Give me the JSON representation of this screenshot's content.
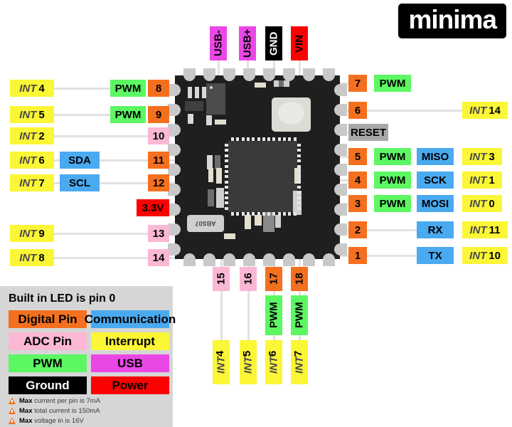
{
  "logo": {
    "text": "minima"
  },
  "legend": {
    "title": "Built in LED is pin 0",
    "items": [
      {
        "label": "Digital Pin",
        "color": "#f4701f",
        "text_color": "#000000"
      },
      {
        "label": "Communication",
        "color": "#4aaaf0",
        "text_color": "#000000"
      },
      {
        "label": "ADC Pin",
        "color": "#fbb8d4",
        "text_color": "#000000"
      },
      {
        "label": "Interrupt",
        "color": "#fbf636",
        "text_color": "#000000"
      },
      {
        "label": "PWM",
        "color": "#5cf763",
        "text_color": "#000000"
      },
      {
        "label": "USB",
        "color": "#ea47e6",
        "text_color": "#000000"
      },
      {
        "label": "Ground",
        "color": "#000000",
        "text_color": "#ffffff"
      },
      {
        "label": "Power",
        "color": "#fb0101",
        "text_color": "#000000"
      }
    ],
    "warnings": [
      {
        "bold": "Max",
        "rest": " current per pin is 7mA"
      },
      {
        "bold": "Max",
        "rest": " total current is 150mA"
      },
      {
        "bold": "Max",
        "rest": " voltage in is 16V"
      }
    ]
  },
  "top_pins": [
    {
      "label": "USB-",
      "type": "usb"
    },
    {
      "label": "USB+",
      "type": "usb"
    },
    {
      "label": "GND",
      "type": "ground"
    },
    {
      "label": "VIN",
      "type": "power"
    }
  ],
  "bottom_pins": [
    {
      "pin": "15",
      "pin_type": "adc",
      "pwm": "",
      "int_tag": "INT",
      "int_num": "4"
    },
    {
      "pin": "16",
      "pin_type": "adc",
      "pwm": "",
      "int_tag": "INT",
      "int_num": "5"
    },
    {
      "pin": "17",
      "pin_type": "digital",
      "pwm": "PWM",
      "int_tag": "INT",
      "int_num": "6"
    },
    {
      "pin": "18",
      "pin_type": "digital",
      "pwm": "PWM",
      "int_tag": "INT",
      "int_num": "7"
    }
  ],
  "left_pins": [
    {
      "int_tag": "INT",
      "int_num": "4",
      "comm": "",
      "extra": "PWM",
      "extra_type": "pwm",
      "pin": "8",
      "pin_type": "digital"
    },
    {
      "int_tag": "INT",
      "int_num": "5",
      "comm": "",
      "extra": "PWM",
      "extra_type": "pwm",
      "pin": "9",
      "pin_type": "digital"
    },
    {
      "int_tag": "INT",
      "int_num": "2",
      "comm": "",
      "extra": "",
      "extra_type": "",
      "pin": "10",
      "pin_type": "adc"
    },
    {
      "int_tag": "INT",
      "int_num": "6",
      "comm": "SDA",
      "extra": "",
      "extra_type": "",
      "pin": "11",
      "pin_type": "digital"
    },
    {
      "int_tag": "INT",
      "int_num": "7",
      "comm": "SCL",
      "extra": "",
      "extra_type": "",
      "pin": "12",
      "pin_type": "digital"
    },
    {
      "int_tag": "",
      "int_num": "",
      "comm": "",
      "extra": "",
      "extra_type": "",
      "pin": "3.3V",
      "pin_type": "power"
    },
    {
      "int_tag": "INT",
      "int_num": "9",
      "comm": "",
      "extra": "",
      "extra_type": "",
      "pin": "13",
      "pin_type": "adc"
    },
    {
      "int_tag": "INT",
      "int_num": "8",
      "comm": "",
      "extra": "",
      "extra_type": "",
      "pin": "14",
      "pin_type": "adc"
    }
  ],
  "right_pins": [
    {
      "pin": "7",
      "pin_type": "digital",
      "pwm": "PWM",
      "comm": "",
      "int_tag": "",
      "int_num": ""
    },
    {
      "pin": "6",
      "pin_type": "digital",
      "pwm": "",
      "comm": "",
      "int_tag": "INT",
      "int_num": "14"
    },
    {
      "pin": "RESET",
      "pin_type": "reset",
      "pwm": "",
      "comm": "",
      "int_tag": "",
      "int_num": ""
    },
    {
      "pin": "5",
      "pin_type": "digital",
      "pwm": "PWM",
      "comm": "MISO",
      "int_tag": "INT",
      "int_num": "3"
    },
    {
      "pin": "4",
      "pin_type": "digital",
      "pwm": "PWM",
      "comm": "SCK",
      "int_tag": "INT",
      "int_num": "1"
    },
    {
      "pin": "3",
      "pin_type": "digital",
      "pwm": "PWM",
      "comm": "MOSI",
      "int_tag": "INT",
      "int_num": "0"
    },
    {
      "pin": "2",
      "pin_type": "digital",
      "pwm": "",
      "comm": "RX",
      "int_tag": "INT",
      "int_num": "11"
    },
    {
      "pin": "1",
      "pin_type": "digital",
      "pwm": "",
      "comm": "TX",
      "int_tag": "INT",
      "int_num": "10"
    }
  ],
  "board": {
    "crystal_label": "ABS07"
  }
}
